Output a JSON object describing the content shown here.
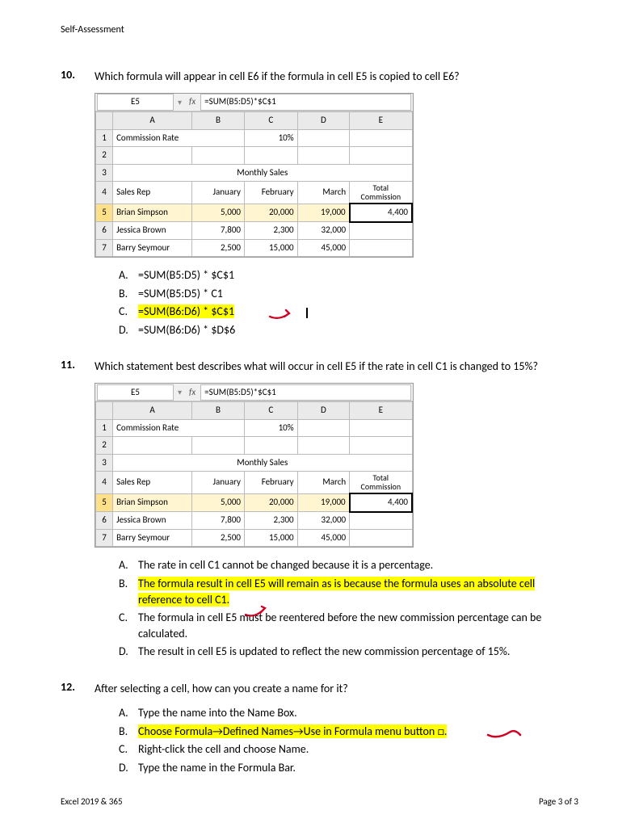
{
  "header": "Self-Assessment",
  "footer_left": "Excel 2019 & 365",
  "footer_right": "Page 3 of 3",
  "q10": {
    "num": "10.",
    "text": "Which formula will appear in cell E6 if the formula in cell E5 is copied to cell E6?",
    "namebox": "E5",
    "fx": "fx",
    "formula": "=SUM(B5:D5)*$C$1",
    "cols": [
      "A",
      "B",
      "C",
      "D",
      "E"
    ],
    "r1": {
      "a": "Commission Rate",
      "c": "10%"
    },
    "r3_merge": "Monthly Sales",
    "r4": {
      "a": "Sales Rep",
      "b": "January",
      "c": "February",
      "d": "March",
      "e_top": "Total",
      "e_bot": "Commission"
    },
    "r5": {
      "a": "Brian Simpson",
      "b": "5,000",
      "c": "20,000",
      "d": "19,000",
      "e": "4,400"
    },
    "r6": {
      "a": "Jessica Brown",
      "b": "7,800",
      "c": "2,300",
      "d": "32,000"
    },
    "r7": {
      "a": "Barry Seymour",
      "b": "2,500",
      "c": "15,000",
      "d": "45,000"
    },
    "ans": {
      "A": "=SUM(B5:D5) * $C$1",
      "B": "=SUM(B5:D5) * C1",
      "C": "=SUM(B6:D6) * $C$1",
      "D": "=SUM(B6:D6) * $D$6"
    }
  },
  "q11": {
    "num": "11.",
    "text": "Which statement best describes what will occur in cell E5 if the rate in cell C1 is changed to 15%?",
    "ans": {
      "A": "The rate in cell C1 cannot be changed because it is a percentage.",
      "B": "The formula result in cell E5 will remain as is because the formula uses an absolute cell reference to cell C1.",
      "C": "The formula in cell E5 must be reentered before the new commission percentage can be calculated.",
      "D": "The result in cell E5 is updated to reflect the new commission percentage of 15%."
    }
  },
  "q12": {
    "num": "12.",
    "text": "After selecting a cell, how can you create a name for it?",
    "ans": {
      "A": "Type the name into the Name Box.",
      "B_p1": "Choose Formula",
      "B_p2": "Defined Names",
      "B_p3": "Use in Formula menu button ",
      "B_icon": "□",
      "C": "Right-click the cell and choose Name.",
      "D": "Type the name in the Formula Bar."
    }
  }
}
